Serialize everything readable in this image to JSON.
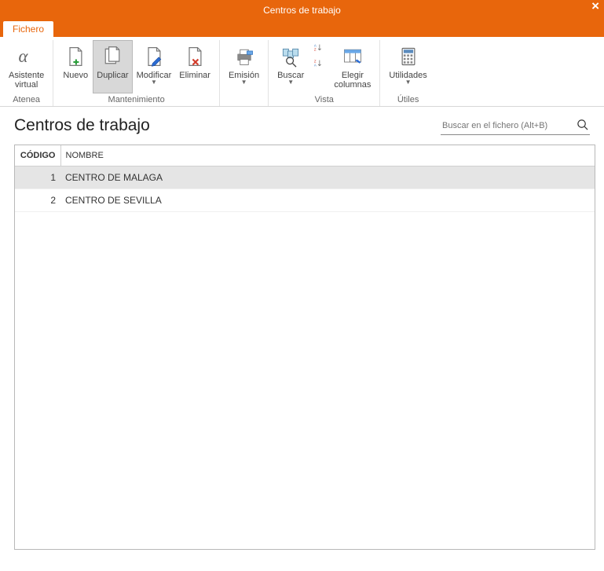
{
  "window": {
    "title": "Centros de trabajo"
  },
  "tab": {
    "label": "Fichero"
  },
  "ribbon": {
    "groups": [
      {
        "label": "Atenea",
        "items": [
          {
            "label": "Asistente\nvirtual",
            "icon": "alpha-icon",
            "dropdown": false,
            "pressed": false
          }
        ]
      },
      {
        "label": "Mantenimiento",
        "items": [
          {
            "label": "Nuevo",
            "icon": "doc-new-icon",
            "dropdown": false,
            "pressed": false
          },
          {
            "label": "Duplicar",
            "icon": "doc-duplicate-icon",
            "dropdown": false,
            "pressed": true
          },
          {
            "label": "Modificar",
            "icon": "doc-edit-icon",
            "dropdown": true,
            "pressed": false
          },
          {
            "label": "Eliminar",
            "icon": "doc-delete-icon",
            "dropdown": false,
            "pressed": false
          }
        ]
      },
      {
        "label": "",
        "items": [
          {
            "label": "Emisión",
            "icon": "print-icon",
            "dropdown": true,
            "pressed": false
          }
        ]
      },
      {
        "label": "Vista",
        "items": [
          {
            "label": "Buscar",
            "icon": "find-icon",
            "dropdown": true,
            "pressed": false
          },
          {
            "label": "",
            "icon": "sort-az-icon",
            "dropdown": false,
            "pressed": false,
            "stack_with_next": true
          },
          {
            "label": "",
            "icon": "sort-za-icon",
            "dropdown": false,
            "pressed": false
          },
          {
            "label": "Elegir\ncolumnas",
            "icon": "columns-icon",
            "dropdown": false,
            "pressed": false
          }
        ]
      },
      {
        "label": "Útiles",
        "items": [
          {
            "label": "Utilidades",
            "icon": "calculator-icon",
            "dropdown": true,
            "pressed": false
          }
        ]
      }
    ]
  },
  "page": {
    "title": "Centros de trabajo"
  },
  "search": {
    "placeholder": "Buscar en el fichero (Alt+B)",
    "value": ""
  },
  "grid": {
    "columns": [
      "CÓDIGO",
      "NOMBRE"
    ],
    "rows": [
      {
        "codigo": "1",
        "nombre": "CENTRO DE MALAGA",
        "selected": true
      },
      {
        "codigo": "2",
        "nombre": "CENTRO DE SEVILLA",
        "selected": false
      }
    ]
  }
}
